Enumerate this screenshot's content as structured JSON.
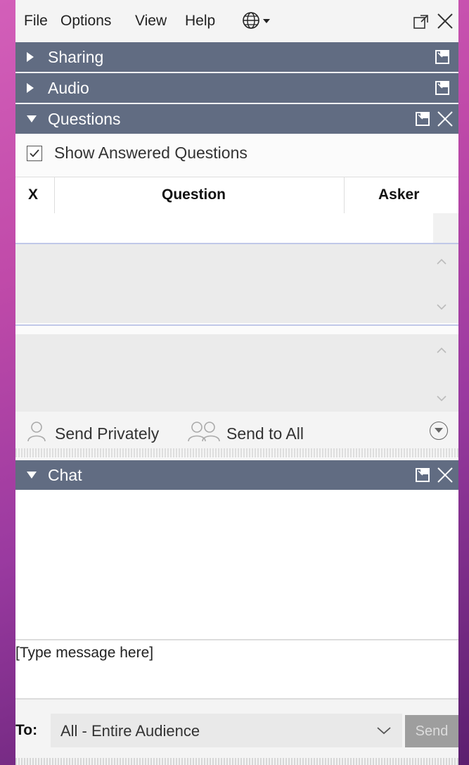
{
  "menu": {
    "file": "File",
    "options": "Options",
    "view": "View",
    "help": "Help",
    "globe_icon": "globe-icon"
  },
  "sections": {
    "sharing": "Sharing",
    "audio": "Audio",
    "questions": "Questions",
    "chat": "Chat"
  },
  "questions": {
    "show_answered_label": "Show Answered Questions",
    "show_answered_checked": true,
    "columns": [
      "X",
      "Question",
      "Asker"
    ],
    "send_privately": "Send Privately",
    "send_to_all": "Send to All"
  },
  "chat": {
    "message_placeholder": "[Type message here]",
    "to_label": "To:",
    "to_value": "All - Entire Audience",
    "send_label": "Send"
  },
  "colors": {
    "header_bg": "#616c82",
    "panel_bg": "#f4f4f4",
    "send_disabled": "#9e9e9e"
  }
}
